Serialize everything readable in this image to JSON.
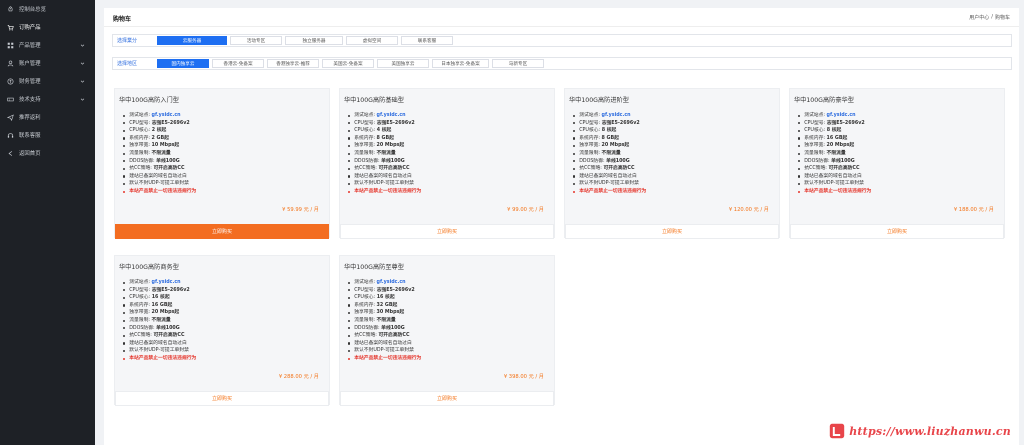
{
  "sidebar": {
    "items": [
      {
        "label": "控制台总览",
        "icon": "rocket-icon",
        "has_chevron": false,
        "active": false
      },
      {
        "label": "订购产品",
        "icon": "cart-icon",
        "has_chevron": false,
        "active": true
      },
      {
        "label": "产品管理",
        "icon": "grid-icon",
        "has_chevron": true,
        "active": false
      },
      {
        "label": "账户管理",
        "icon": "user-icon",
        "has_chevron": true,
        "active": false
      },
      {
        "label": "财务管理",
        "icon": "wallet-icon",
        "has_chevron": true,
        "active": false
      },
      {
        "label": "技术支持",
        "icon": "ticket-icon",
        "has_chevron": true,
        "active": false
      },
      {
        "label": "推荐返利",
        "icon": "send-icon",
        "has_chevron": false,
        "active": false
      },
      {
        "label": "联系客服",
        "icon": "headset-icon",
        "has_chevron": false,
        "active": false
      },
      {
        "label": "返回首页",
        "icon": "home-icon",
        "has_chevron": false,
        "active": false
      }
    ]
  },
  "header": {
    "title": "购物车",
    "breadcrumb": [
      "用户中心",
      "/",
      "购物车"
    ]
  },
  "filters": {
    "category_label": "选择業分",
    "categories": [
      {
        "label": "云服务器",
        "active": true
      },
      {
        "label": "活动专区",
        "active": false
      },
      {
        "label": "独立服务器",
        "active": false
      },
      {
        "label": "虚拟空间",
        "active": false
      },
      {
        "label": "联系客服",
        "active": false
      }
    ],
    "region_label": "选择地区",
    "regions": [
      {
        "label": "国内独享云",
        "active": true
      },
      {
        "label": "香港云-免备案",
        "active": false
      },
      {
        "label": "香港独享云-推荐",
        "active": false
      },
      {
        "label": "美国云-免备案",
        "active": false
      },
      {
        "label": "美国独享云",
        "active": false
      },
      {
        "label": "日本独享云-免备案",
        "active": false
      },
      {
        "label": "马新专区",
        "active": false
      }
    ]
  },
  "spec_labels": {
    "test": "测试站点:",
    "cpu_model": "CPU型号:",
    "cpu_cores": "CPU核心:",
    "ram": "系统内存:",
    "bandwidth": "独享带宽:",
    "traffic": "流量限制:",
    "ddos": "DDOS防御:",
    "cc": "抗CC策略:",
    "note1": "建站已备案的域名自动过白",
    "note2": "默认不封UDP-可提工单封禁",
    "warn": "本站产品禁止一切违法违规行为"
  },
  "products": [
    {
      "title": "华中100G高防入门型",
      "test": "gf.ysidc.cn",
      "cpu_model": "志强E5-2696v2",
      "cpu_cores": "2 核起",
      "ram": "2 GB起",
      "bandwidth": "10 Mbps起",
      "traffic": "不限流量",
      "ddos": "单线100G",
      "cc": "可开启高防CC",
      "price": "¥ 59.99 元 / 月",
      "buy": "立即购买",
      "highlighted": true
    },
    {
      "title": "华中100G高防基础型",
      "test": "gf.ysidc.cn",
      "cpu_model": "志强E5-2696v2",
      "cpu_cores": "4 核起",
      "ram": "8 GB起",
      "bandwidth": "20 Mbps起",
      "traffic": "不限流量",
      "ddos": "单线100G",
      "cc": "可开启高防CC",
      "price": "¥ 99.00 元 / 月",
      "buy": "立即购买",
      "highlighted": false
    },
    {
      "title": "华中100G高防进阶型",
      "test": "gf.ysidc.cn",
      "cpu_model": "志强E5-2696v2",
      "cpu_cores": "8 核起",
      "ram": "8 GB起",
      "bandwidth": "20 Mbps起",
      "traffic": "不限流量",
      "ddos": "单线100G",
      "cc": "可开启高防CC",
      "price": "¥ 120.00 元 / 月",
      "buy": "立即购买",
      "highlighted": false
    },
    {
      "title": "华中100G高防豪华型",
      "test": "gf.ysidc.cn",
      "cpu_model": "志强E5-2696v2",
      "cpu_cores": "8 核起",
      "ram": "16 GB起",
      "bandwidth": "20 Mbps起",
      "traffic": "不限流量",
      "ddos": "单线100G",
      "cc": "可开启高防CC",
      "price": "¥ 188.00 元 / 月",
      "buy": "立即购买",
      "highlighted": false
    },
    {
      "title": "华中100G高防商务型",
      "test": "gf.ysidc.cn",
      "cpu_model": "志强E5-2696v2",
      "cpu_cores": "16 核起",
      "ram": "16 GB起",
      "bandwidth": "20 Mbps起",
      "traffic": "不限流量",
      "ddos": "单线100G",
      "cc": "可开启高防CC",
      "price": "¥ 288.00 元 / 月",
      "buy": "立即购买",
      "highlighted": false
    },
    {
      "title": "华中100G高防至尊型",
      "test": "gf.ysidc.cn",
      "cpu_model": "志强E5-2696v2",
      "cpu_cores": "16 核起",
      "ram": "32 GB起",
      "bandwidth": "30 Mbps起",
      "traffic": "不限流量",
      "ddos": "单线100G",
      "cc": "可开启高防CC",
      "price": "¥ 398.00 元 / 月",
      "buy": "立即购买",
      "highlighted": false
    }
  ],
  "watermark": {
    "text": "https://www.liuzhanwu.cn"
  },
  "colors": {
    "accent": "#1e6ff2",
    "buy": "#f36d21",
    "warn": "#e5352b",
    "sidebar": "#1e2126"
  }
}
